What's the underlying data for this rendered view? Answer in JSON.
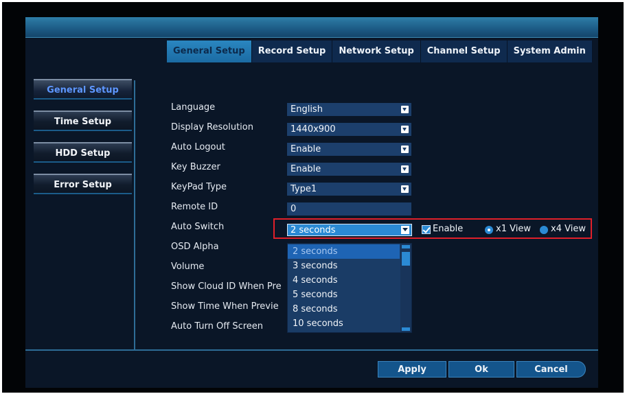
{
  "tabs": [
    {
      "label": "General Setup",
      "active": true
    },
    {
      "label": "Record Setup"
    },
    {
      "label": "Network Setup"
    },
    {
      "label": "Channel Setup"
    },
    {
      "label": "System Admin"
    }
  ],
  "sidebar": {
    "items": [
      {
        "label": "General Setup",
        "active": true
      },
      {
        "label": "Time Setup"
      },
      {
        "label": "HDD Setup"
      },
      {
        "label": "Error Setup"
      }
    ]
  },
  "settings": {
    "language": {
      "label": "Language",
      "value": "English"
    },
    "display_resolution": {
      "label": "Display Resolution",
      "value": "1440x900"
    },
    "auto_logout": {
      "label": "Auto Logout",
      "value": "Enable"
    },
    "key_buzzer": {
      "label": "Key Buzzer",
      "value": "Enable"
    },
    "keypad_type": {
      "label": "KeyPad Type",
      "value": "Type1"
    },
    "remote_id": {
      "label": "Remote ID",
      "value": "0"
    },
    "auto_switch": {
      "label": "Auto Switch",
      "value": "2 seconds",
      "enable_label": "Enable",
      "enabled": true,
      "x1_view_label": "x1 View",
      "x4_view_label": "x4 View",
      "selected_view": "x1 View"
    },
    "osd_alpha": {
      "label": "OSD Alpha"
    },
    "volume": {
      "label": "Volume"
    },
    "show_cloud_id": {
      "label": "Show Cloud ID When Pre"
    },
    "show_time": {
      "label": "Show Time When Previe"
    },
    "auto_turn_off": {
      "label": "Auto Turn Off Screen"
    }
  },
  "dropdown": {
    "options": [
      "2 seconds",
      "3 seconds",
      "4 seconds",
      "5 seconds",
      "8 seconds",
      "10 seconds"
    ],
    "selected": "2 seconds"
  },
  "buttons": {
    "apply": "Apply",
    "ok": "Ok",
    "cancel": "Cancel"
  },
  "colors": {
    "accent": "#2b8ad4",
    "highlight_box": "#e0202a",
    "background": "#0a1627"
  }
}
